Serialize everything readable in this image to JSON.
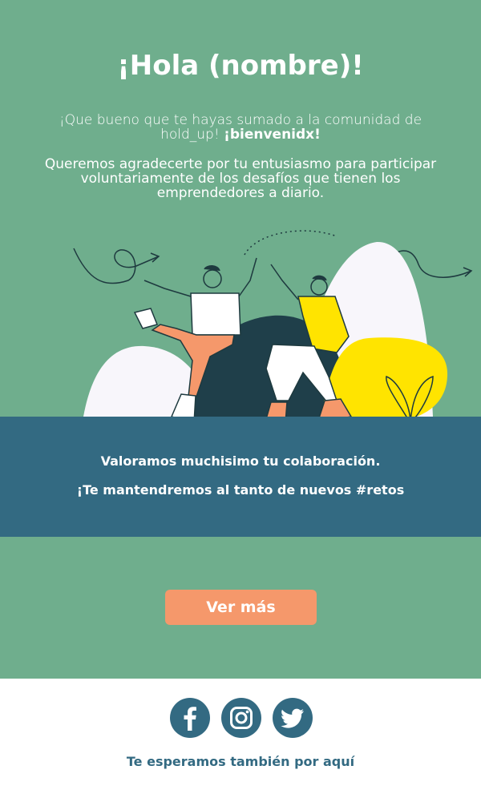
{
  "header": {
    "title": "¡Hola (nombre)!"
  },
  "intro": {
    "text": "¡Que bueno que te hayas sumado a la comunidad de hold_up! ",
    "highlight": "¡bienvenidx!"
  },
  "thanks": {
    "text": "Queremos agradecerte por tu entusiasmo para participar voluntariamente de los desafíos que tienen los emprendedores a diario."
  },
  "band": {
    "line1": "Valoramos muchisimo tu colaboración.",
    "line2": "¡Te mantendremos al tanto de nuevos #retos"
  },
  "cta": {
    "label": "Ver más"
  },
  "footer": {
    "social": [
      {
        "icon": "facebook-icon"
      },
      {
        "icon": "instagram-icon"
      },
      {
        "icon": "twitter-icon"
      }
    ],
    "tagline": "Te esperamos también por aquí"
  },
  "colors": {
    "hero_bg": "#6fae8d",
    "band_bg": "#336a82",
    "cta_bg": "#f5986b",
    "text_light": "#ffffff"
  }
}
